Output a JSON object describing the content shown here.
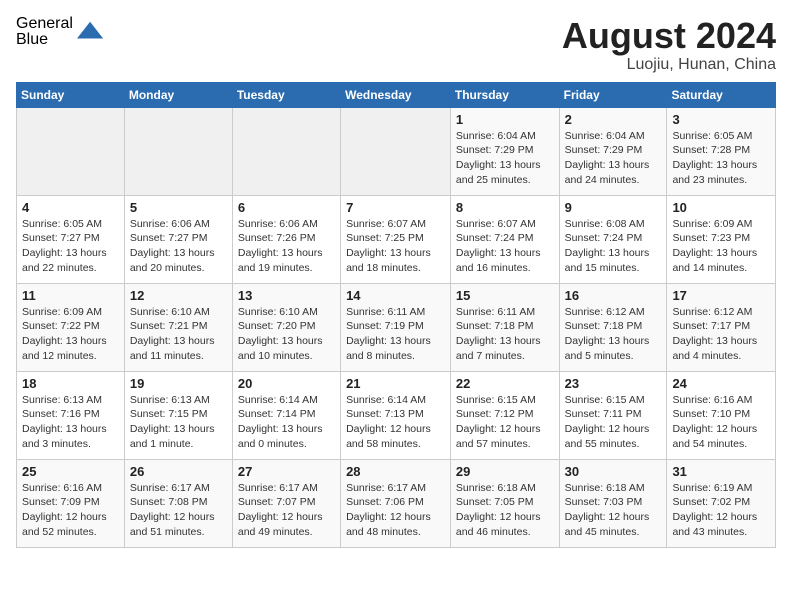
{
  "logo": {
    "general": "General",
    "blue": "Blue"
  },
  "title": {
    "month_year": "August 2024",
    "location": "Luojiu, Hunan, China"
  },
  "header_days": [
    "Sunday",
    "Monday",
    "Tuesday",
    "Wednesday",
    "Thursday",
    "Friday",
    "Saturday"
  ],
  "weeks": [
    [
      {
        "day": "",
        "info": ""
      },
      {
        "day": "",
        "info": ""
      },
      {
        "day": "",
        "info": ""
      },
      {
        "day": "",
        "info": ""
      },
      {
        "day": "1",
        "info": "Sunrise: 6:04 AM\nSunset: 7:29 PM\nDaylight: 13 hours\nand 25 minutes."
      },
      {
        "day": "2",
        "info": "Sunrise: 6:04 AM\nSunset: 7:29 PM\nDaylight: 13 hours\nand 24 minutes."
      },
      {
        "day": "3",
        "info": "Sunrise: 6:05 AM\nSunset: 7:28 PM\nDaylight: 13 hours\nand 23 minutes."
      }
    ],
    [
      {
        "day": "4",
        "info": "Sunrise: 6:05 AM\nSunset: 7:27 PM\nDaylight: 13 hours\nand 22 minutes."
      },
      {
        "day": "5",
        "info": "Sunrise: 6:06 AM\nSunset: 7:27 PM\nDaylight: 13 hours\nand 20 minutes."
      },
      {
        "day": "6",
        "info": "Sunrise: 6:06 AM\nSunset: 7:26 PM\nDaylight: 13 hours\nand 19 minutes."
      },
      {
        "day": "7",
        "info": "Sunrise: 6:07 AM\nSunset: 7:25 PM\nDaylight: 13 hours\nand 18 minutes."
      },
      {
        "day": "8",
        "info": "Sunrise: 6:07 AM\nSunset: 7:24 PM\nDaylight: 13 hours\nand 16 minutes."
      },
      {
        "day": "9",
        "info": "Sunrise: 6:08 AM\nSunset: 7:24 PM\nDaylight: 13 hours\nand 15 minutes."
      },
      {
        "day": "10",
        "info": "Sunrise: 6:09 AM\nSunset: 7:23 PM\nDaylight: 13 hours\nand 14 minutes."
      }
    ],
    [
      {
        "day": "11",
        "info": "Sunrise: 6:09 AM\nSunset: 7:22 PM\nDaylight: 13 hours\nand 12 minutes."
      },
      {
        "day": "12",
        "info": "Sunrise: 6:10 AM\nSunset: 7:21 PM\nDaylight: 13 hours\nand 11 minutes."
      },
      {
        "day": "13",
        "info": "Sunrise: 6:10 AM\nSunset: 7:20 PM\nDaylight: 13 hours\nand 10 minutes."
      },
      {
        "day": "14",
        "info": "Sunrise: 6:11 AM\nSunset: 7:19 PM\nDaylight: 13 hours\nand 8 minutes."
      },
      {
        "day": "15",
        "info": "Sunrise: 6:11 AM\nSunset: 7:18 PM\nDaylight: 13 hours\nand 7 minutes."
      },
      {
        "day": "16",
        "info": "Sunrise: 6:12 AM\nSunset: 7:18 PM\nDaylight: 13 hours\nand 5 minutes."
      },
      {
        "day": "17",
        "info": "Sunrise: 6:12 AM\nSunset: 7:17 PM\nDaylight: 13 hours\nand 4 minutes."
      }
    ],
    [
      {
        "day": "18",
        "info": "Sunrise: 6:13 AM\nSunset: 7:16 PM\nDaylight: 13 hours\nand 3 minutes."
      },
      {
        "day": "19",
        "info": "Sunrise: 6:13 AM\nSunset: 7:15 PM\nDaylight: 13 hours\nand 1 minute."
      },
      {
        "day": "20",
        "info": "Sunrise: 6:14 AM\nSunset: 7:14 PM\nDaylight: 13 hours\nand 0 minutes."
      },
      {
        "day": "21",
        "info": "Sunrise: 6:14 AM\nSunset: 7:13 PM\nDaylight: 12 hours\nand 58 minutes."
      },
      {
        "day": "22",
        "info": "Sunrise: 6:15 AM\nSunset: 7:12 PM\nDaylight: 12 hours\nand 57 minutes."
      },
      {
        "day": "23",
        "info": "Sunrise: 6:15 AM\nSunset: 7:11 PM\nDaylight: 12 hours\nand 55 minutes."
      },
      {
        "day": "24",
        "info": "Sunrise: 6:16 AM\nSunset: 7:10 PM\nDaylight: 12 hours\nand 54 minutes."
      }
    ],
    [
      {
        "day": "25",
        "info": "Sunrise: 6:16 AM\nSunset: 7:09 PM\nDaylight: 12 hours\nand 52 minutes."
      },
      {
        "day": "26",
        "info": "Sunrise: 6:17 AM\nSunset: 7:08 PM\nDaylight: 12 hours\nand 51 minutes."
      },
      {
        "day": "27",
        "info": "Sunrise: 6:17 AM\nSunset: 7:07 PM\nDaylight: 12 hours\nand 49 minutes."
      },
      {
        "day": "28",
        "info": "Sunrise: 6:17 AM\nSunset: 7:06 PM\nDaylight: 12 hours\nand 48 minutes."
      },
      {
        "day": "29",
        "info": "Sunrise: 6:18 AM\nSunset: 7:05 PM\nDaylight: 12 hours\nand 46 minutes."
      },
      {
        "day": "30",
        "info": "Sunrise: 6:18 AM\nSunset: 7:03 PM\nDaylight: 12 hours\nand 45 minutes."
      },
      {
        "day": "31",
        "info": "Sunrise: 6:19 AM\nSunset: 7:02 PM\nDaylight: 12 hours\nand 43 minutes."
      }
    ]
  ]
}
